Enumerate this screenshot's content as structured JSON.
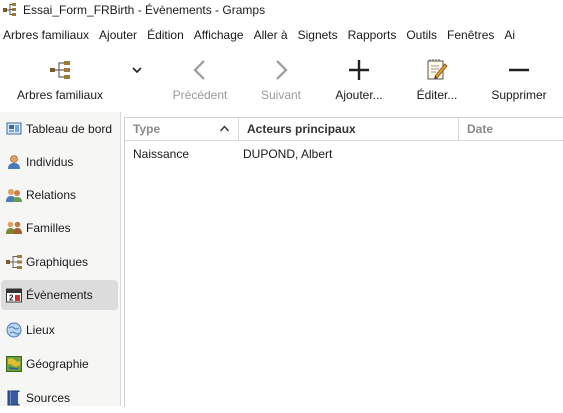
{
  "window": {
    "title": "Essai_Form_FRBirth - Évènements - Gramps"
  },
  "menubar": [
    "Arbres familiaux",
    "Ajouter",
    "Édition",
    "Affichage",
    "Aller à",
    "Signets",
    "Rapports",
    "Outils",
    "Fenêtres",
    "Ai"
  ],
  "toolbar": {
    "family_trees": "Arbres familiaux",
    "previous": "Précédent",
    "next": "Suivant",
    "add": "Ajouter...",
    "edit": "Éditer...",
    "remove": "Supprimer"
  },
  "sidebar": {
    "items": [
      {
        "label": "Tableau de bord",
        "icon": "dashboard-icon"
      },
      {
        "label": "Individus",
        "icon": "person-icon"
      },
      {
        "label": "Relations",
        "icon": "relationships-icon"
      },
      {
        "label": "Familles",
        "icon": "families-icon"
      },
      {
        "label": "Graphiques",
        "icon": "pedigree-icon"
      },
      {
        "label": "Évènements",
        "icon": "events-calendar-icon",
        "active": true
      },
      {
        "label": "Lieux",
        "icon": "globe-icon"
      },
      {
        "label": "Géographie",
        "icon": "map-icon"
      },
      {
        "label": "Sources",
        "icon": "book-icon"
      }
    ]
  },
  "table": {
    "columns": [
      "Type",
      "Acteurs principaux",
      "Date"
    ],
    "sort_column": "Type",
    "rows": [
      {
        "type": "Naissance",
        "actors": "DUPOND, Albert",
        "date": ""
      }
    ]
  }
}
